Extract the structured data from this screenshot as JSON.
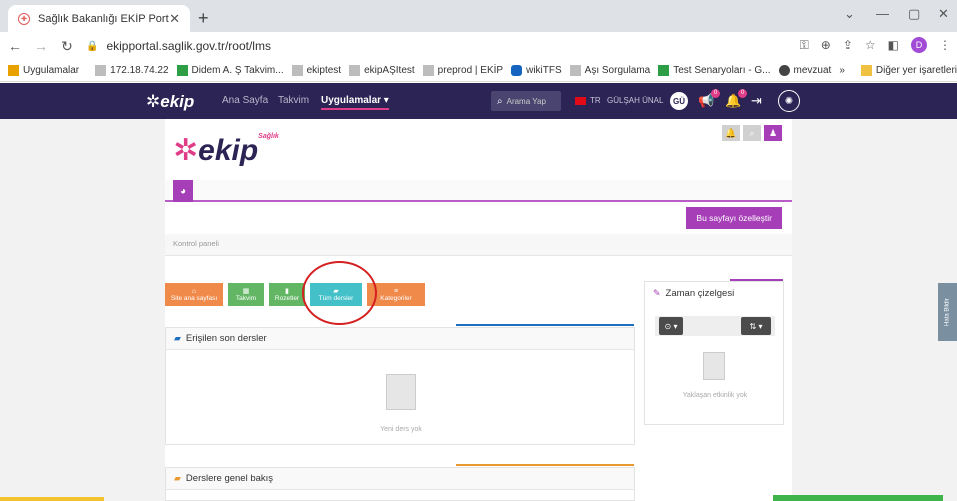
{
  "browser": {
    "tab_title": "Sağlık Bakanlığı EKİP Portal",
    "tab_close": "✕",
    "new_tab": "+",
    "url": "ekipportal.saglik.gov.tr/root/lms",
    "profile_initial": "D"
  },
  "bookmarks": [
    {
      "label": "Uygulamalar",
      "color": "#e8a100"
    },
    {
      "label": "172.18.74.22",
      "color": "#bdbdbd"
    },
    {
      "label": "Didem A. Ş Takvim...",
      "color": "#2e9e46"
    },
    {
      "label": "ekiptest",
      "color": "#bdbdbd"
    },
    {
      "label": "ekipAŞItest",
      "color": "#bdbdbd"
    },
    {
      "label": "preprod | EKİP",
      "color": "#bdbdbd"
    },
    {
      "label": "wikiTFS",
      "color": "#1565c0"
    },
    {
      "label": "Aşı Sorgulama",
      "color": "#bdbdbd"
    },
    {
      "label": "Test Senaryoları - G...",
      "color": "#2e9e46"
    },
    {
      "label": "mevzuat",
      "color": "#444444"
    },
    {
      "label": "»",
      "color": ""
    },
    {
      "label": "Diğer yer işaretleri",
      "color": "#f0c040"
    }
  ],
  "appnav": {
    "logo": "ekip",
    "links": [
      "Ana Sayfa",
      "Takvim",
      "Uygulamalar ▾"
    ],
    "search_placeholder": "Arama Yap",
    "lang": "TR",
    "user_name": "GÜLŞAH ÜNAL",
    "avatar": "GÜ",
    "notif_badge_1": "0",
    "notif_badge_2": "0"
  },
  "page": {
    "logo": "ekip",
    "logo_sub": "Sağlık",
    "customize_button": "Bu sayfayı özelleştir",
    "breadcrumb": "Kontrol paneli",
    "tiles": [
      {
        "label": "Site ana sayfası",
        "icon": "🏠",
        "color": "#f08a4b"
      },
      {
        "label": "Takvim",
        "icon": "▦",
        "color": "#62b664"
      },
      {
        "label": "Rozetler",
        "icon": "▮",
        "color": "#62b664"
      },
      {
        "label": "Tüm dersler",
        "icon": "▰",
        "color": "#43c0c8"
      },
      {
        "label": "Kategoriler",
        "icon": "≡",
        "color": "#f08a4b"
      }
    ],
    "recent_courses": {
      "title": "Erişilen son dersler",
      "empty": "Yeni ders yok"
    },
    "overview": {
      "title": "Derslere genel bakış"
    },
    "timeline": {
      "title": "Zaman çizelgesi",
      "empty": "Yaklaşan etkinlik yok",
      "ctrl_left": "⊙ ▾",
      "ctrl_right": "⇅ ▾"
    },
    "feedback": "Hata Bildir"
  }
}
